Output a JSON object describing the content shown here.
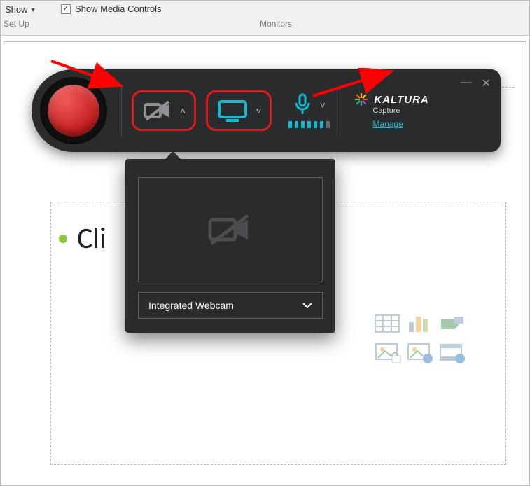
{
  "ribbon": {
    "show_label": "Show",
    "setup_group": "Set Up",
    "media_controls_label": "Show Media Controls",
    "monitors_group": "Monitors"
  },
  "slide": {
    "bullet_text": "Cli"
  },
  "kaltura": {
    "brand_name": "KALTURA",
    "brand_sub": "Capture",
    "manage_label": "Manage",
    "camera_dropdown_selected": "Integrated Webcam"
  }
}
